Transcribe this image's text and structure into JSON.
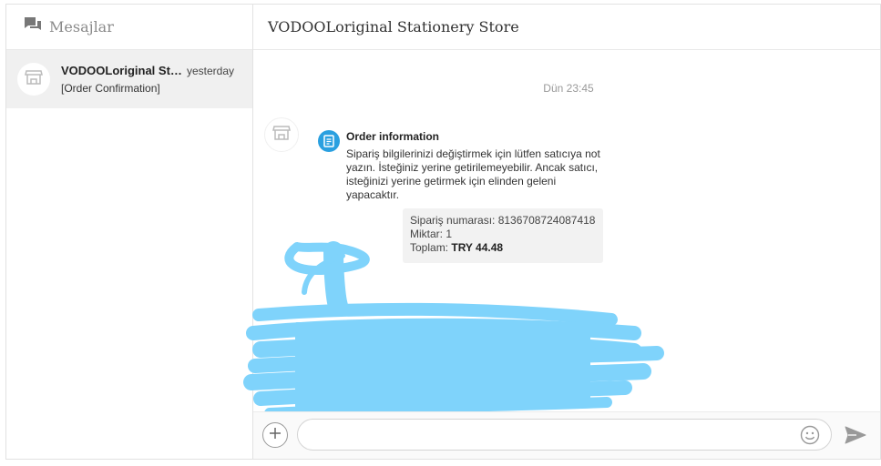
{
  "sidebar": {
    "title": "Mesajlar",
    "conversations": [
      {
        "name": "VODOOLoriginal Stationery Store",
        "time": "yesterday",
        "preview": "[Order Confirmation]"
      }
    ]
  },
  "chat": {
    "store_title": "VODOOLoriginal Stationery Store",
    "timestamp": "Dün 23:45",
    "message": {
      "title": "Order information",
      "body": "Sipariş bilgilerinizi değiştirmek için lütfen satıcıya not yazın. İsteğiniz yerine getirilemeyebilir. Ancak satıcı, isteğinizi yerine getirmek için elinden geleni yapacaktır.",
      "order": {
        "number_label": "Sipariş numarası: 8136708724087418",
        "quantity_label": "Miktar: 1",
        "total_label": "Toplam:",
        "total_value": "TRY 44.48"
      }
    }
  },
  "composer": {
    "placeholder": ""
  },
  "colors": {
    "accent": "#2aa0e0",
    "scribble": "#7fd3fb",
    "selected_bg": "#f0f0f0"
  },
  "icons": [
    "chat-bubbles-icon",
    "store-icon",
    "document-icon",
    "plus-icon",
    "emoji-icon",
    "send-icon"
  ]
}
